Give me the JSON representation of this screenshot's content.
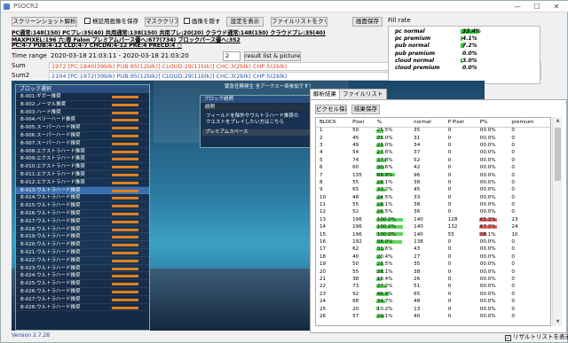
{
  "window": {
    "title": "PSOCR2",
    "minimize": "—",
    "maximize": "☐",
    "close": "✕"
  },
  "toolbar": {
    "capture": "スクリーンショット解析",
    "save_verified": "検証用画像を保存",
    "mask_clear": "マスククリア",
    "hide_image": "画像を隠す",
    "show_settings": "設定を表示",
    "clear_filelist": "ファイルリストをクリア",
    "save_screen": "画面保存"
  },
  "info_lines": [
    "PC通常:148(150) PCプレ:35(40) 共用通常:138(150) 共用プレ:20(20) クラウド通常:148(150) クラウドプレ:35(40)",
    "MAXPIXEL:196 六:専 Falon プレミアムパース優へ:677(734) ブロックパース優へ:352",
    "PC:4-7 PUB:4-12 CLD:4-7 CHCDN:4-12 PRE:4 PRECD:4 ○"
  ],
  "time_range": {
    "label": "Time range",
    "value": "2020-03-18 21:03:11 - 2020-03-18 21:03:20",
    "count": "2",
    "button": "result list & picture"
  },
  "sum": {
    "label": "Sum",
    "value": "1972 [PC:1840(39blk) PUB:95(12blk)] CLOUD:29(11blk)] CHC:3(2blk) CHP:5(2blk)"
  },
  "sum2": {
    "label": "Sum2",
    "value": "2104 [PC:1972(39blk) PUB:95(12blk)] CLOUD:29(11blk)] CHC:3(2blk) CHP:5(2blk)"
  },
  "fill_rate": {
    "title": "Fill rate",
    "rows": [
      {
        "label": "pc normal",
        "text": "33.4%",
        "value": 0.334
      },
      {
        "label": "pc premium",
        "text": "4.1%",
        "value": 0.041
      },
      {
        "label": "pub normal",
        "text": "7.2%",
        "value": 0.072
      },
      {
        "label": "pub premium",
        "text": "0.0%",
        "value": 0.0
      },
      {
        "label": "cloud normal",
        "text": "3.0%",
        "value": 0.03
      },
      {
        "label": "cloud premium",
        "text": "0.0%",
        "value": 0.0
      }
    ]
  },
  "block_list": {
    "header": "ブロック選択",
    "items": [
      "B-001:ギガー推奨",
      "B-002:ノーマル推奨",
      "B-003:ハード推奨",
      "B-004:ベリーハード推奨",
      "B-005:スーパーハード推奨",
      "B-006:スーパーハード推奨",
      "B-007:スーパーハード推奨",
      "B-008:エクストラハード推奨",
      "B-009:エクストラハード推奨",
      "B-010:エクストラハード推奨",
      "B-011:エクストラハード推奨",
      "B-012:エクストラハード推奨",
      "B-013:ウルトラハード推奨",
      "B-014:ウルトラハード推奨",
      "B-015:ウルトラハード推奨",
      "B-016:ウルトラハード推奨",
      "B-017:ウルトラハード推奨",
      "B-018:ウルトラハード推奨",
      "B-019:ウルトラハード推奨",
      "B-020:ウルトラハード推奨",
      "B-021:ウルトラハード推奨",
      "B-022:ウルトラハード推奨",
      "B-023:ウルトラハード推奨",
      "B-024:ウルトラハード推奨",
      "B-025:ウルトラハード推奨",
      "B-026:ウルトラハード推奨",
      "B-027:ウルトラハード推奨",
      "B-028:ウルトラハード推奨"
    ],
    "selected_index": 12
  },
  "block_info": {
    "header": "ブロック説明",
    "sub": "説明",
    "text": "フィールドを除外やウルトラハード推奨の\nクエストをプレイしたい方はこちら",
    "premium": "プレミアムスペース"
  },
  "game_banner": "緊急任務発生 全アークス一斉参加です！",
  "version": "Version 2.7.28",
  "tabs": [
    {
      "label": "解析結果"
    },
    {
      "label": "ファイルリスト"
    }
  ],
  "result_buttons": {
    "pixel_save": "ピクセル保存",
    "result_save": "結果保存"
  },
  "table": {
    "columns": [
      "BLOCK",
      "Pixel",
      "%",
      "normal",
      "P Pixel",
      "P%",
      "premium"
    ],
    "rows": [
      [
        "1",
        "50",
        "25.5%",
        "35",
        "0",
        "00.0%",
        "0"
      ],
      [
        "2",
        "45",
        "23.0%",
        "31",
        "0",
        "00.0%",
        "0"
      ],
      [
        "3",
        "49",
        "25.0%",
        "34",
        "0",
        "00.0%",
        "0"
      ],
      [
        "4",
        "54",
        "27.6%",
        "37",
        "0",
        "00.0%",
        "0"
      ],
      [
        "5",
        "74",
        "37.8%",
        "52",
        "0",
        "00.0%",
        "0"
      ],
      [
        "6",
        "60",
        "30.6%",
        "42",
        "0",
        "00.0%",
        "0"
      ],
      [
        "7",
        "135",
        "68.9%",
        "96",
        "0",
        "00.0%",
        "0"
      ],
      [
        "8",
        "55",
        "28.1%",
        "38",
        "0",
        "00.0%",
        "0"
      ],
      [
        "9",
        "65",
        "33.2%",
        "45",
        "0",
        "00.0%",
        "0"
      ],
      [
        "10",
        "48",
        "24.5%",
        "33",
        "0",
        "00.0%",
        "0"
      ],
      [
        "11",
        "55",
        "28.1%",
        "38",
        "0",
        "00.0%",
        "0"
      ],
      [
        "12",
        "52",
        "26.5%",
        "36",
        "0",
        "00.0%",
        "0"
      ],
      [
        "13",
        "196",
        "100.0%",
        "140",
        "128",
        "65.3%",
        "23"
      ],
      [
        "14",
        "196",
        "100.0%",
        "140",
        "132",
        "67.3%",
        "24"
      ],
      [
        "15",
        "196",
        "100.0%",
        "140",
        "55",
        "28.1%",
        "10"
      ],
      [
        "16",
        "192",
        "98.0%",
        "138",
        "0",
        "00.0%",
        "0"
      ],
      [
        "17",
        "62",
        "31.6%",
        "43",
        "0",
        "00.0%",
        "0"
      ],
      [
        "18",
        "40",
        "20.4%",
        "27",
        "0",
        "00.0%",
        "0"
      ],
      [
        "19",
        "50",
        "25.5%",
        "35",
        "0",
        "00.0%",
        "0"
      ],
      [
        "20",
        "55",
        "28.1%",
        "38",
        "0",
        "00.0%",
        "0"
      ],
      [
        "21",
        "38",
        "19.4%",
        "26",
        "0",
        "00.0%",
        "0"
      ],
      [
        "22",
        "73",
        "37.2%",
        "51",
        "0",
        "00.0%",
        "0"
      ],
      [
        "23",
        "92",
        "46.9%",
        "65",
        "0",
        "00.0%",
        "0"
      ],
      [
        "24",
        "68",
        "34.7%",
        "48",
        "0",
        "00.0%",
        "0"
      ],
      [
        "25",
        "20",
        "10.2%",
        "13",
        "0",
        "00.0%",
        "0"
      ],
      [
        "26",
        "57",
        "29.1%",
        "40",
        "0",
        "00.0%",
        "0"
      ]
    ]
  },
  "save_result_list": "リザルトリストを表示",
  "colors": {
    "bar_green": "#33cc33",
    "bar_red": "#ee4444",
    "sum_red": "#dd4422",
    "sum_blue": "#2255aa"
  }
}
